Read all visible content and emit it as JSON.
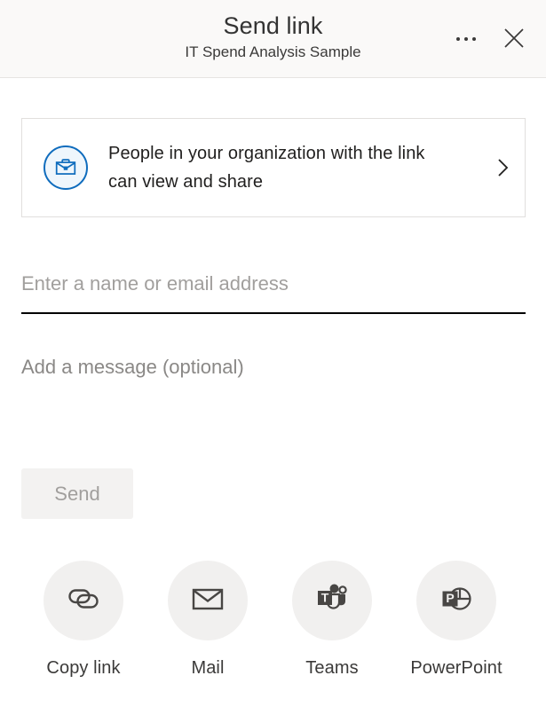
{
  "header": {
    "title": "Send link",
    "subtitle": "IT Spend Analysis Sample",
    "more_label": "More options",
    "close_label": "Close",
    "background_color": "#faf9f8"
  },
  "permission": {
    "icon": "briefcase-icon",
    "line1": "People in your organization with the link",
    "line2": "can view and share",
    "chevron": "chevron-right-icon",
    "accent_color": "#0f6cbd",
    "icon_background": "#eff6fc"
  },
  "recipients": {
    "placeholder": "Enter a name or email address",
    "value": ""
  },
  "message": {
    "placeholder": "Add a message (optional)",
    "value": ""
  },
  "send": {
    "label": "Send",
    "enabled": false,
    "background_color": "#f3f2f1",
    "text_color": "#a19f9d"
  },
  "share_targets": [
    {
      "label": "Copy link",
      "icon": "link-icon"
    },
    {
      "label": "Mail",
      "icon": "envelope-icon"
    },
    {
      "label": "Teams",
      "icon": "teams-icon"
    },
    {
      "label": "PowerPoint",
      "icon": "powerpoint-icon"
    }
  ]
}
